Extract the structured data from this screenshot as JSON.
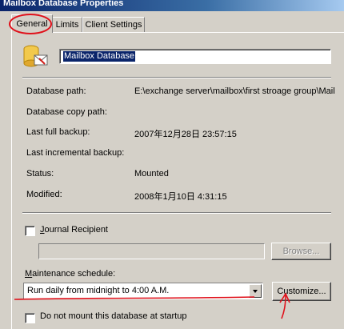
{
  "window": {
    "title": "Mailbox Database Properties"
  },
  "tabs": [
    {
      "label": "General",
      "active": true
    },
    {
      "label": "Limits",
      "active": false
    },
    {
      "label": "Client Settings",
      "active": false
    }
  ],
  "general": {
    "name_value": "Mailbox Database",
    "fields": [
      {
        "label": "Database path:",
        "value": "E:\\exchange server\\mailbox\\first stroage group\\Mail"
      },
      {
        "label": "Database copy path:",
        "value": ""
      },
      {
        "label": "Last full backup:",
        "value": "2007年12月28日 23:57:15"
      },
      {
        "label": "Last incremental backup:",
        "value": ""
      },
      {
        "label": "Status:",
        "value": "Mounted"
      },
      {
        "label": "Modified:",
        "value": "2008年1月10日 4:31:15"
      }
    ],
    "journal": {
      "label_prefix": "",
      "label_underline": "J",
      "label_rest": "ournal Recipient",
      "checked": false,
      "input_value": ""
    },
    "browse_button": "Browse...",
    "maintenance": {
      "label_underline": "M",
      "label_rest": "aintenance schedule:",
      "selected": "Run daily from midnight to 4:00 A.M."
    },
    "customize_button": "Customize...",
    "do_not_mount": {
      "label": "Do not mount this database at startup",
      "checked": false
    }
  },
  "annotation_color": "#e0101a"
}
